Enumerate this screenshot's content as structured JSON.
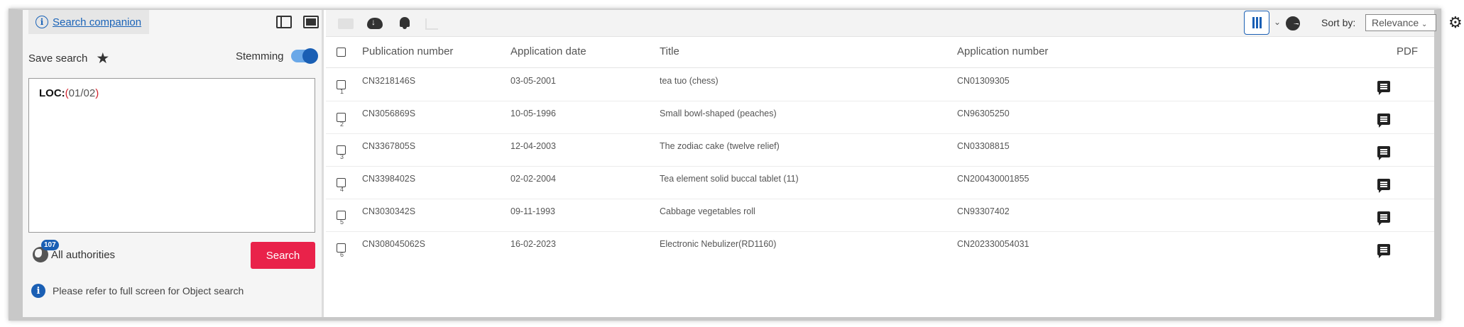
{
  "search_panel": {
    "companion_link": "Search companion",
    "save_search_label": "Save search",
    "stemming_label": "Stemming",
    "stemming_on": true,
    "query_keyword": "LOC:",
    "query_open": "(",
    "query_value": "01/02",
    "query_close": ")",
    "authorities_count": "107",
    "authorities_label": "All authorities",
    "search_button": "Search",
    "notice": "Please refer to full screen for Object search"
  },
  "toolbar": {
    "sort_label": "Sort by:",
    "sort_value": "Relevance"
  },
  "table": {
    "headers": {
      "publication_number": "Publication number",
      "application_date": "Application date",
      "title": "Title",
      "application_number": "Application number",
      "pdf": "PDF"
    },
    "rows": [
      {
        "index": "1",
        "publication_number": "CN3218146S",
        "application_date": "03-05-2001",
        "title": "tea tuo (chess)",
        "application_number": "CN01309305"
      },
      {
        "index": "2",
        "publication_number": "CN3056869S",
        "application_date": "10-05-1996",
        "title": "Small bowl-shaped (peaches)",
        "application_number": "CN96305250"
      },
      {
        "index": "3",
        "publication_number": "CN3367805S",
        "application_date": "12-04-2003",
        "title": "The zodiac cake (twelve relief)",
        "application_number": "CN03308815"
      },
      {
        "index": "4",
        "publication_number": "CN3398402S",
        "application_date": "02-02-2004",
        "title": "Tea element solid buccal tablet (11)",
        "application_number": "CN200430001855"
      },
      {
        "index": "5",
        "publication_number": "CN3030342S",
        "application_date": "09-11-1993",
        "title": "Cabbage vegetables roll",
        "application_number": "CN93307402"
      },
      {
        "index": "6",
        "publication_number": "CN308045062S",
        "application_date": "16-02-2023",
        "title": "Electronic Nebulizer(RD1160)",
        "application_number": "CN202330054031"
      }
    ]
  },
  "colors": {
    "accent": "#1a5fb4",
    "search_button": "#e9224a",
    "query_paren": "#d0202a"
  }
}
